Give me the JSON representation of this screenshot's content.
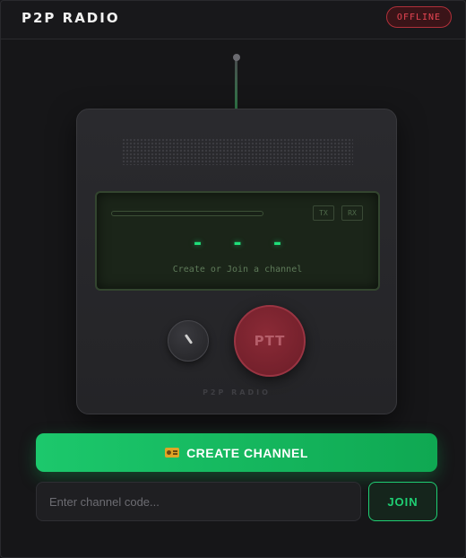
{
  "header": {
    "app_title": "P2P RADIO",
    "status_badge": "OFFLINE"
  },
  "radio": {
    "display": {
      "channel_readout": "- - -",
      "tx_label": "TX",
      "rx_label": "RX",
      "message": "Create or Join a channel"
    },
    "ptt_label": "PTT",
    "brand_label": "P2P RADIO"
  },
  "actions": {
    "create_icon": "radio-icon",
    "create_label": "CREATE CHANNEL",
    "channel_code_placeholder": "Enter channel code...",
    "channel_code_value": "",
    "join_label": "JOIN"
  },
  "colors": {
    "background": "#161618",
    "accent_green": "#1cc86c",
    "status_red": "#e64552",
    "ptt_red": "#7a2330",
    "display_green": "#1fe07a"
  }
}
